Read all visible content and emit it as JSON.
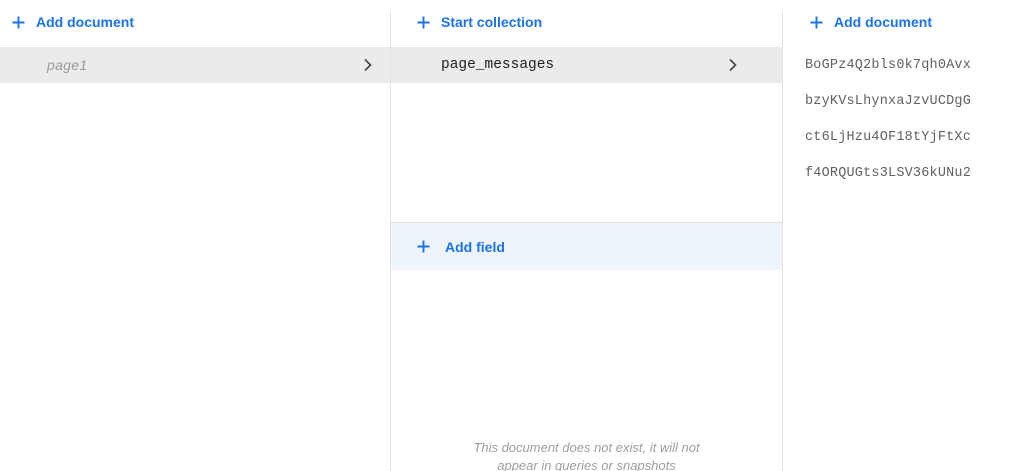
{
  "colors": {
    "accent": "#1a73e8",
    "selected_row": "#ebebeb",
    "field_bar": "#eef4fc"
  },
  "column1": {
    "action_label": "Add document",
    "action_icon": "plus-icon",
    "selected_document": "page1",
    "chevron_icon": "chevron-right-icon"
  },
  "column2": {
    "action_label": "Start collection",
    "action_icon": "plus-icon",
    "collection": "page_messages",
    "chevron_icon": "chevron-right-icon",
    "add_field_label": "Add field",
    "notice_line1": "This document does not exist, it will not",
    "notice_line2": "appear in queries or snapshots"
  },
  "column3": {
    "action_label": "Add document",
    "action_icon": "plus-icon",
    "documents": [
      "BoGPz4Q2bls0k7qh0Avx",
      "bzyKVsLhynxaJzvUCDgG",
      "ct6LjHzu4OF18tYjFtXc",
      "f4ORQUGts3LSV36kUNu2"
    ]
  }
}
